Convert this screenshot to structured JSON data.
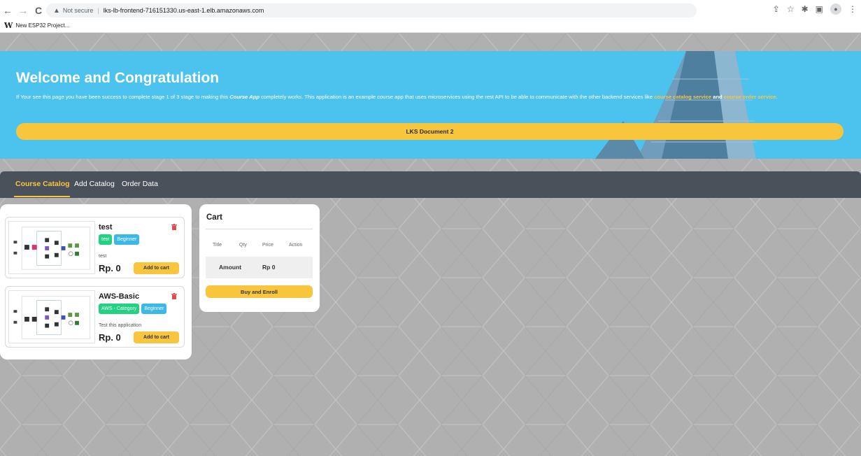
{
  "browser": {
    "nav": {
      "back": "←",
      "forward": "→",
      "reload": "C"
    },
    "security_label": "Not secure",
    "separator": "|",
    "url": "lks-lb-frontend-716151330.us-east-1.elb.amazonaws.com",
    "bookmark": {
      "icon": "W",
      "label": "New ESP32 Project..."
    }
  },
  "hero": {
    "title": "Welcome and Congratulation",
    "text_part1": "If Your see this page you have been success to complete stage 1 of 3 stage to making this ",
    "text_app": "Course App",
    "text_part2": " completely works. This application is an example course app that uses microservices using the rest API to be able to communicate with the other backend services like ",
    "link1": "course catalog service",
    "text_and": " and ",
    "link2": "course order service",
    "text_end": ".",
    "button_label": "LKS Document 2"
  },
  "nav": {
    "items": [
      "Course Catalog",
      "Add Catalog",
      "Order Data"
    ]
  },
  "courses": [
    {
      "title": "test",
      "category": "test",
      "level": "Beginner",
      "description": "test",
      "price": "Rp. 0",
      "button": "Add to cart"
    },
    {
      "title": "AWS-Basic",
      "category": "AWS - Category",
      "level": "Beginner",
      "description": "Test this application",
      "price": "Rp. 0",
      "button": "Add to cart"
    }
  ],
  "cart": {
    "title": "Cart",
    "headers": [
      "Title",
      "Qty",
      "Price",
      "Action"
    ],
    "amount_label": "Amount",
    "amount_value": "Rp 0",
    "buy_button": "Buy and Enroll"
  },
  "colors": {
    "hero_bg": "#4cc3ee",
    "accent_yellow": "#f8c63d",
    "navbar_bg": "#4b515b",
    "tag_green": "#23d183",
    "tag_blue": "#3cb8e8",
    "trash_red": "#e5484d"
  },
  "icons": [
    "back-arrow-icon",
    "forward-arrow-icon",
    "reload-icon",
    "warning-icon",
    "share-icon",
    "star-icon",
    "extensions-icon",
    "sidepanel-icon",
    "profile-icon",
    "menu-dots-icon",
    "trash-icon"
  ]
}
